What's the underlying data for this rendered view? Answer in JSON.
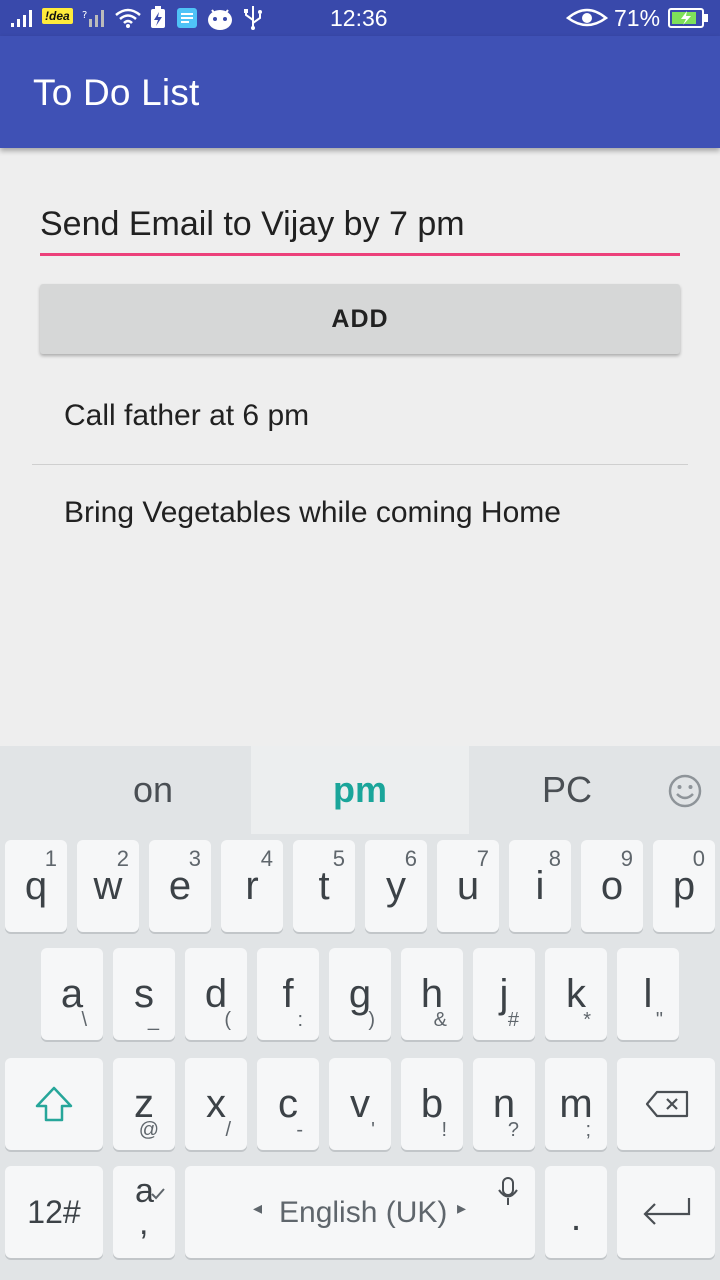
{
  "status_bar": {
    "carrier": "!dea",
    "time": "12:36",
    "battery_percent": "71%"
  },
  "app_bar": {
    "title": "To Do List"
  },
  "input": {
    "value": "Send Email to Vijay by 7 pm"
  },
  "add_button": {
    "label": "ADD"
  },
  "todos": [
    "Call father at 6 pm",
    "Bring Vegetables while coming Home"
  ],
  "keyboard": {
    "suggestions": [
      "on",
      "pm",
      "PC"
    ],
    "row1": [
      {
        "key": "q",
        "alt": "1"
      },
      {
        "key": "w",
        "alt": "2"
      },
      {
        "key": "e",
        "alt": "3"
      },
      {
        "key": "r",
        "alt": "4"
      },
      {
        "key": "t",
        "alt": "5"
      },
      {
        "key": "y",
        "alt": "6"
      },
      {
        "key": "u",
        "alt": "7"
      },
      {
        "key": "i",
        "alt": "8"
      },
      {
        "key": "o",
        "alt": "9"
      },
      {
        "key": "p",
        "alt": "0"
      }
    ],
    "row2": [
      {
        "key": "a",
        "alt": "\\"
      },
      {
        "key": "s",
        "alt": "_"
      },
      {
        "key": "d",
        "alt": "("
      },
      {
        "key": "f",
        "alt": ":"
      },
      {
        "key": "g",
        "alt": ")"
      },
      {
        "key": "h",
        "alt": "&"
      },
      {
        "key": "j",
        "alt": "#"
      },
      {
        "key": "k",
        "alt": "*"
      },
      {
        "key": "l",
        "alt": "\""
      }
    ],
    "row3": [
      {
        "key": "z",
        "alt": "@"
      },
      {
        "key": "x",
        "alt": "/"
      },
      {
        "key": "c",
        "alt": "-"
      },
      {
        "key": "v",
        "alt": "'"
      },
      {
        "key": "b",
        "alt": "!"
      },
      {
        "key": "n",
        "alt": "?"
      },
      {
        "key": "m",
        "alt": ";"
      }
    ],
    "symbols_key": "12#",
    "lang_key_main": "a",
    "lang_key_alt": ",",
    "space_label": "English (UK)",
    "period_key": "."
  }
}
